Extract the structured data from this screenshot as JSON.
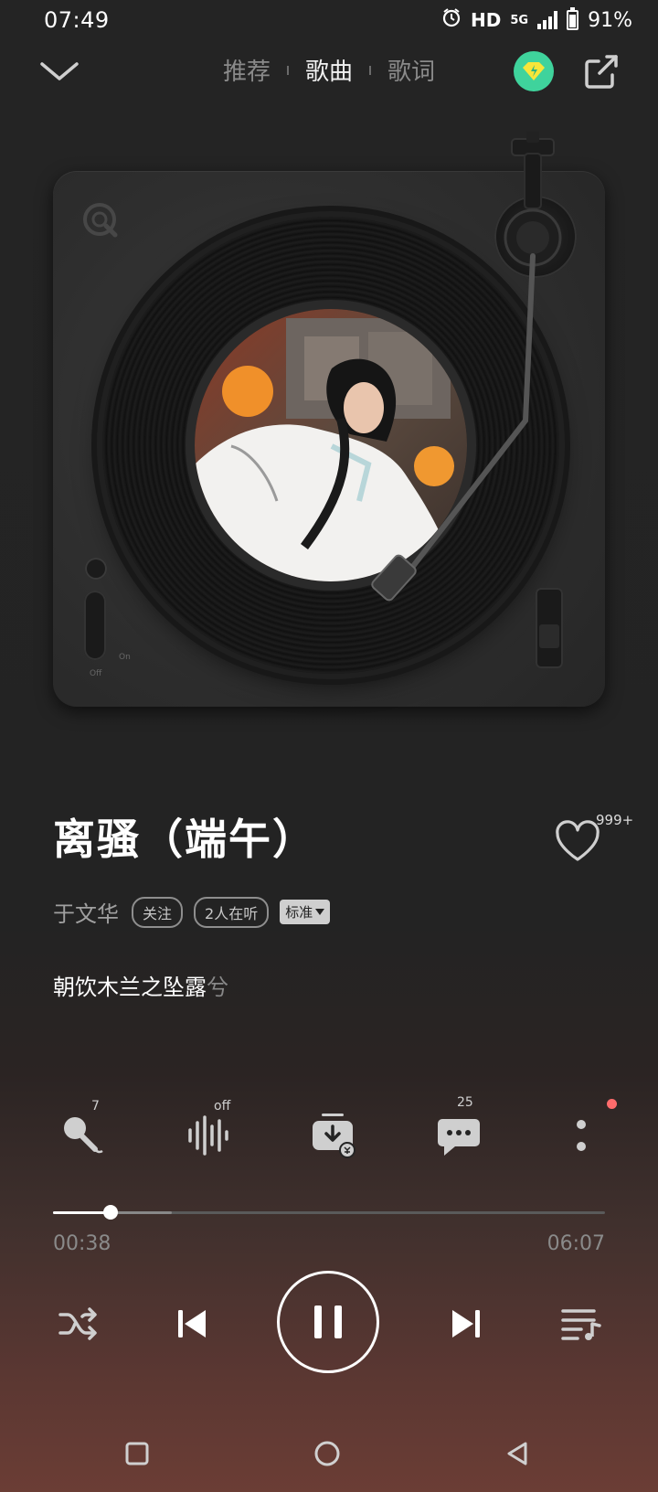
{
  "status_bar": {
    "time": "07:49",
    "hd": "HD",
    "network": "5G",
    "battery": "91%"
  },
  "header": {
    "tabs": [
      {
        "label": "推荐",
        "active": false
      },
      {
        "label": "歌曲",
        "active": true
      },
      {
        "label": "歌词",
        "active": false
      }
    ]
  },
  "turntable": {
    "switch_off": "Off",
    "switch_on": "On"
  },
  "song": {
    "title": "离骚（端午）",
    "like_count": "999+",
    "artist": "于文华",
    "follow_label": "关注",
    "listeners_label": "2人在听",
    "quality_label": "标准",
    "lyric_sung": "朝饮木兰之坠露",
    "lyric_pending": "兮"
  },
  "actions": {
    "karaoke_count": "7",
    "effect_state": "off",
    "comment_count": "25"
  },
  "progress": {
    "current": "00:38",
    "total": "06:07",
    "played_fraction": 0.104
  },
  "colors": {
    "vip_accent": "#3fd39c",
    "notification_dot": "#ff6c6c"
  }
}
